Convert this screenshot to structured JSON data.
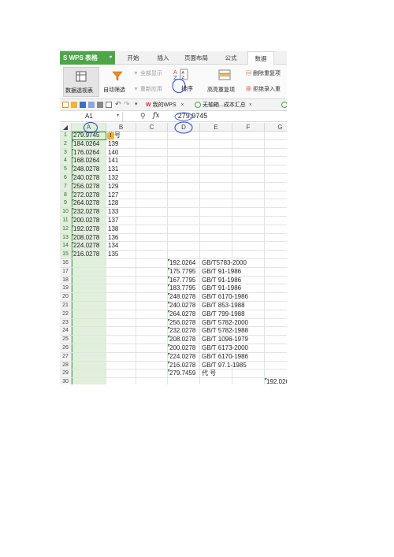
{
  "app": {
    "brand": "WPS 表格",
    "tabs": [
      "开始",
      "插入",
      "页面布局",
      "公式",
      "数据"
    ],
    "active_tab": "数据"
  },
  "ribbon": {
    "pivot": "数据透视表",
    "autofilter": "自动筛选",
    "show_all": "全部显示",
    "reapply": "重新应用",
    "sort": "排序",
    "highlight_dup": "高亮重复项",
    "remove_dup": "删除重复项",
    "reject_dup": "拒绝录入重"
  },
  "quick_tabs": [
    "我的WPS",
    "无轴箱...成本汇总"
  ],
  "formula_bar": {
    "name_box": "A1",
    "fx": "fx",
    "value": "'279.9745"
  },
  "columns": [
    "A",
    "B",
    "C",
    "D",
    "E",
    "F",
    "G"
  ],
  "rows": [
    "1",
    "2",
    "3",
    "4",
    "5",
    "6",
    "7",
    "8",
    "9",
    "10",
    "11",
    "12",
    "13",
    "14",
    "15",
    "16",
    "17",
    "18",
    "19",
    "20",
    "21",
    "22",
    "23",
    "24",
    "25",
    "26",
    "27",
    "28",
    "29",
    "30"
  ],
  "colA": [
    "279.9745",
    "184.0264",
    "176.0264",
    "168.0264",
    "248.0278",
    "240.0278",
    "256.0278",
    "272.0278",
    "264.0278",
    "232.0278",
    "200.0278",
    "192.0278",
    "208.0278",
    "224.0278",
    "216.0278"
  ],
  "colB": [
    "代号",
    "139",
    "140",
    "141",
    "131",
    "132",
    "129",
    "127",
    "128",
    "133",
    "137",
    "138",
    "136",
    "134",
    "135"
  ],
  "colD": [
    "192.0264",
    "175.7795",
    "167.7795",
    "183.7795",
    "248.0278",
    "240.0278",
    "264.0278",
    "256.0278",
    "232.0278",
    "208.0278",
    "200.0278",
    "224.0278",
    "216.0278",
    "279.7459"
  ],
  "colE": [
    "GB/T5783-2000",
    "GB/T 91-1986",
    "GB/T 91-1986",
    "GB/T 91-1986",
    "GB/T 6170-1986",
    "GB/T 853-1988",
    "GB/T 799-1988",
    "GB/T 5782-2000",
    "GB/T 5782-1988",
    "GB/T 1096-1979",
    "GB/T 6173-2000",
    "GB/T 6170-1986",
    "GB/T 97.1-1985",
    "代 号"
  ],
  "g30": "192.026",
  "colors": {
    "accent": "#4da64a",
    "selection": "#e1f0dc",
    "annotation": "#1f3fd6"
  }
}
